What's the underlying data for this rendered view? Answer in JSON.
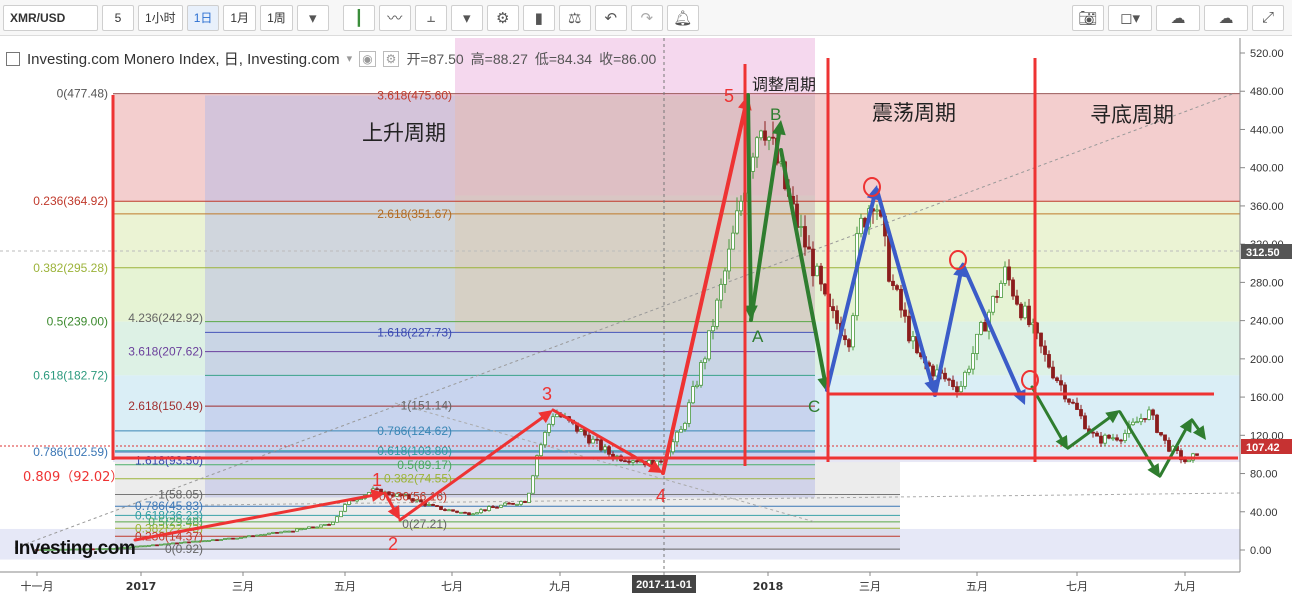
{
  "toolbar": {
    "symbol": "XMR/USD",
    "interval": "5",
    "btn_1h": "1小时",
    "btn_1d": "1日",
    "btn_1m": "1月",
    "btn_1w": "1周"
  },
  "legend": {
    "title": "Investing.com Monero Index, 日, Investing.com",
    "open": "开=87.50",
    "high": "高=88.27",
    "low": "低=84.34",
    "close": "收=86.00"
  },
  "watermark": "Investing.com",
  "price_badge_top": "312.50",
  "price_badge_last": "107.42",
  "colors": {
    "up": "#4a9a3f",
    "down": "#8b1d1d",
    "red_annotation": "#ee3333",
    "blue_arrow": "#3b5cc8",
    "green_arrow": "#2f7d2f"
  },
  "chart_data": {
    "type": "line",
    "title": "Investing.com Monero Index, 日, Investing.com",
    "ohlc_last": {
      "open": 87.5,
      "high": 88.27,
      "low": 84.34,
      "close": 86.0
    },
    "y_axis": {
      "ticks": [
        0,
        40,
        80,
        120,
        160,
        200,
        240,
        280,
        320,
        360,
        400,
        440,
        480,
        520
      ],
      "labels": [
        "0.00",
        "40.00",
        "80.00",
        "120.00",
        "160.00",
        "200.00",
        "240.00",
        "280.00",
        "320.00",
        "360.00",
        "400.00",
        "440.00",
        "480.00",
        "520.00"
      ],
      "range": [
        -5,
        530
      ]
    },
    "x_axis": {
      "labels": [
        "十一月",
        "2017",
        "三月",
        "五月",
        "七月",
        "九月",
        "2017-11-01",
        "2018",
        "三月",
        "五月",
        "七月",
        "九月"
      ]
    },
    "series": [
      {
        "x": [
          "2016-11-01",
          "2016-12-15",
          "2017-01-20",
          "2017-03-01",
          "2017-04-01",
          "2017-04-25",
          "2017-05-05",
          "2017-05-20",
          "2017-06-10",
          "2017-06-25",
          "2017-07-15",
          "2017-08-01",
          "2017-08-20",
          "2017-08-26",
          "2017-09-05",
          "2017-09-20",
          "2017-10-10",
          "2017-10-25",
          "2017-11-05",
          "2017-11-20",
          "2017-12-05",
          "2017-12-20",
          "2018-01-01",
          "2018-01-07",
          "2018-01-15",
          "2018-01-25",
          "2018-02-06",
          "2018-02-15",
          "2018-03-01",
          "2018-03-05",
          "2018-03-15",
          "2018-03-25",
          "2018-04-10",
          "2018-04-25",
          "2018-05-05",
          "2018-05-20",
          "2018-06-01",
          "2018-06-10",
          "2018-06-25",
          "2018-07-10",
          "2018-07-25",
          "2018-08-10",
          "2018-08-25",
          "2018-09-05",
          "2018-09-18",
          "2018-09-25"
        ],
        "y": [
          0.5,
          1.5,
          7,
          13,
          20,
          27,
          50,
          62,
          55,
          45,
          38,
          45,
          52,
          100,
          145,
          125,
          98,
          95,
          88,
          125,
          210,
          320,
          420,
          455,
          410,
          355,
          300,
          250,
          220,
          330,
          375,
          280,
          200,
          180,
          170,
          240,
          290,
          255,
          200,
          155,
          115,
          120,
          145,
          110,
          90,
          107
        ]
      }
    ],
    "annotations": {
      "cycles": [
        "上升周期",
        "调整周期",
        "震荡周期",
        "寻底周期"
      ],
      "waves_red": [
        "1",
        "2",
        "3",
        "4",
        "5"
      ],
      "waves_green": [
        "A",
        "B",
        "C"
      ],
      "fib_left": [
        "0(477.48)",
        "0.236(364.92)",
        "0.382(295.28)",
        "0.5(239.00)",
        "0.618(182.72)",
        "0.786(102.59)",
        "0.809（92.02）"
      ],
      "fib_mid": [
        "3.618(475.60)",
        "2.618(351.67)",
        "1.618(227.73)",
        "1(151.14)",
        "0.786(124.62)",
        "0.618(103.80)",
        "0.5(89.17)",
        "0.382(74.55)"
      ],
      "fib_small": [
        "4.236(242.92)",
        "3.618(207.62)",
        "2.618(150.49)",
        "1.618(93.50)",
        "1(58.05)",
        "0.786(45.83)",
        "0.618(36.23)",
        "0.5(29.48)",
        "0.382(22.73)",
        "0.236(14.37)",
        "0(0.92)",
        "0.236(56.16)",
        "0(27.21)"
      ]
    }
  }
}
